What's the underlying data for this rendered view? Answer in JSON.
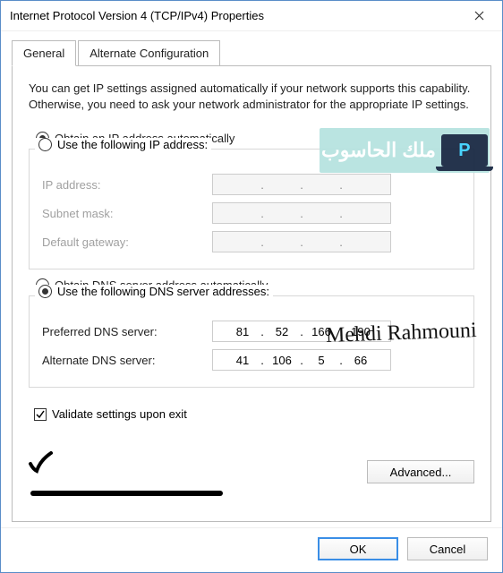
{
  "window": {
    "title": "Internet Protocol Version 4 (TCP/IPv4) Properties"
  },
  "tabs": {
    "general": "General",
    "alternate": "Alternate Configuration"
  },
  "description": "You can get IP settings assigned automatically if your network supports this capability. Otherwise, you need to ask your network administrator for the appropriate IP settings.",
  "ip": {
    "auto_label": "Obtain an IP address automatically",
    "manual_label": "Use the following IP address:",
    "ip_label": "IP address:",
    "subnet_label": "Subnet mask:",
    "gateway_label": "Default gateway:",
    "ip_value": "",
    "subnet_value": "",
    "gateway_value": ""
  },
  "dns": {
    "auto_label": "Obtain DNS server address automatically",
    "manual_label": "Use the following DNS server addresses:",
    "preferred_label": "Preferred DNS server:",
    "alternate_label": "Alternate DNS server:",
    "preferred": {
      "o1": "81",
      "o2": "52",
      "o3": "166",
      "o4": "190"
    },
    "alternate": {
      "o1": "41",
      "o2": "106",
      "o3": "5",
      "o4": "66"
    }
  },
  "validate_label": "Validate settings upon exit",
  "advanced_label": "Advanced...",
  "buttons": {
    "ok": "OK",
    "cancel": "Cancel"
  },
  "annotations": {
    "signature": "Mehdi Rahmouni",
    "watermark_text": "ملك الحاسوب"
  }
}
